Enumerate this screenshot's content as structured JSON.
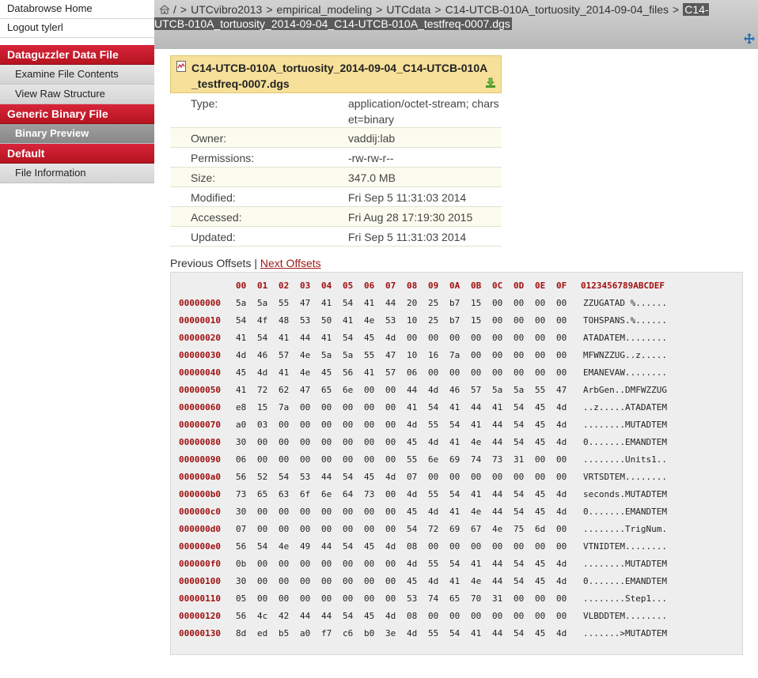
{
  "sidebar": {
    "top_links": [
      "Databrowse Home",
      "Logout tylerl"
    ],
    "sections": [
      {
        "title": "Dataguzzler Data File",
        "items": [
          {
            "label": "Examine File Contents",
            "active": false
          },
          {
            "label": "View Raw Structure",
            "active": false
          }
        ]
      },
      {
        "title": "Generic Binary File",
        "items": [
          {
            "label": "Binary Preview",
            "active": true
          }
        ]
      },
      {
        "title": "Default",
        "items": [
          {
            "label": "File Information",
            "active": false
          }
        ]
      }
    ]
  },
  "breadcrumb": {
    "parts": [
      "/",
      "UTCvibro2013",
      "empirical_modeling",
      "UTCdata",
      "C14-UTCB-010A_tortuosity_2014-09-04_files"
    ],
    "separator": ">",
    "current": "C14-UTCB-010A_tortuosity_2014-09-04_C14-UTCB-010A_testfreq-0007.dgs"
  },
  "file": {
    "title": "C14-UTCB-010A_tortuosity_2014-09-04_C14-UTCB-010A_testfreq-0007.dgs",
    "rows": [
      {
        "key": "Type:",
        "value": "application/octet-stream; charset=binary"
      },
      {
        "key": "Owner:",
        "value": "vaddij:lab"
      },
      {
        "key": "Permissions:",
        "value": "-rw-rw-r--"
      },
      {
        "key": "Size:",
        "value": "347.0 MB"
      },
      {
        "key": "Modified:",
        "value": "Fri Sep 5 11:31:03 2014"
      },
      {
        "key": "Accessed:",
        "value": "Fri Aug 28 17:19:30 2015"
      },
      {
        "key": "Updated:",
        "value": "Fri Sep 5 11:31:03 2014"
      }
    ]
  },
  "offsets": {
    "previous": "Previous Offsets",
    "divider": "|",
    "next": "Next Offsets"
  },
  "hex": {
    "columns": [
      "00",
      "01",
      "02",
      "03",
      "04",
      "05",
      "06",
      "07",
      "08",
      "09",
      "0A",
      "0B",
      "0C",
      "0D",
      "0E",
      "0F"
    ],
    "ascii_header": "0123456789ABCDEF",
    "rows": [
      {
        "offset": "00000000",
        "bytes": [
          "5a",
          "5a",
          "55",
          "47",
          "41",
          "54",
          "41",
          "44",
          "20",
          "25",
          "b7",
          "15",
          "00",
          "00",
          "00",
          "00"
        ],
        "ascii": "ZZUGATAD %......"
      },
      {
        "offset": "00000010",
        "bytes": [
          "54",
          "4f",
          "48",
          "53",
          "50",
          "41",
          "4e",
          "53",
          "10",
          "25",
          "b7",
          "15",
          "00",
          "00",
          "00",
          "00"
        ],
        "ascii": "TOHSPANS.%......"
      },
      {
        "offset": "00000020",
        "bytes": [
          "41",
          "54",
          "41",
          "44",
          "41",
          "54",
          "45",
          "4d",
          "00",
          "00",
          "00",
          "00",
          "00",
          "00",
          "00",
          "00"
        ],
        "ascii": "ATADATEM........"
      },
      {
        "offset": "00000030",
        "bytes": [
          "4d",
          "46",
          "57",
          "4e",
          "5a",
          "5a",
          "55",
          "47",
          "10",
          "16",
          "7a",
          "00",
          "00",
          "00",
          "00",
          "00"
        ],
        "ascii": "MFWNZZUG..z....."
      },
      {
        "offset": "00000040",
        "bytes": [
          "45",
          "4d",
          "41",
          "4e",
          "45",
          "56",
          "41",
          "57",
          "06",
          "00",
          "00",
          "00",
          "00",
          "00",
          "00",
          "00"
        ],
        "ascii": "EMANEVAW........"
      },
      {
        "offset": "00000050",
        "bytes": [
          "41",
          "72",
          "62",
          "47",
          "65",
          "6e",
          "00",
          "00",
          "44",
          "4d",
          "46",
          "57",
          "5a",
          "5a",
          "55",
          "47"
        ],
        "ascii": "ArbGen..DMFWZZUG"
      },
      {
        "offset": "00000060",
        "bytes": [
          "e8",
          "15",
          "7a",
          "00",
          "00",
          "00",
          "00",
          "00",
          "41",
          "54",
          "41",
          "44",
          "41",
          "54",
          "45",
          "4d"
        ],
        "ascii": "..z.....ATADATEM"
      },
      {
        "offset": "00000070",
        "bytes": [
          "a0",
          "03",
          "00",
          "00",
          "00",
          "00",
          "00",
          "00",
          "4d",
          "55",
          "54",
          "41",
          "44",
          "54",
          "45",
          "4d"
        ],
        "ascii": "........MUTADTEM"
      },
      {
        "offset": "00000080",
        "bytes": [
          "30",
          "00",
          "00",
          "00",
          "00",
          "00",
          "00",
          "00",
          "45",
          "4d",
          "41",
          "4e",
          "44",
          "54",
          "45",
          "4d"
        ],
        "ascii": "0.......EMANDTEM"
      },
      {
        "offset": "00000090",
        "bytes": [
          "06",
          "00",
          "00",
          "00",
          "00",
          "00",
          "00",
          "00",
          "55",
          "6e",
          "69",
          "74",
          "73",
          "31",
          "00",
          "00"
        ],
        "ascii": "........Units1.."
      },
      {
        "offset": "000000a0",
        "bytes": [
          "56",
          "52",
          "54",
          "53",
          "44",
          "54",
          "45",
          "4d",
          "07",
          "00",
          "00",
          "00",
          "00",
          "00",
          "00",
          "00"
        ],
        "ascii": "VRTSDTEM........"
      },
      {
        "offset": "000000b0",
        "bytes": [
          "73",
          "65",
          "63",
          "6f",
          "6e",
          "64",
          "73",
          "00",
          "4d",
          "55",
          "54",
          "41",
          "44",
          "54",
          "45",
          "4d"
        ],
        "ascii": "seconds.MUTADTEM"
      },
      {
        "offset": "000000c0",
        "bytes": [
          "30",
          "00",
          "00",
          "00",
          "00",
          "00",
          "00",
          "00",
          "45",
          "4d",
          "41",
          "4e",
          "44",
          "54",
          "45",
          "4d"
        ],
        "ascii": "0.......EMANDTEM"
      },
      {
        "offset": "000000d0",
        "bytes": [
          "07",
          "00",
          "00",
          "00",
          "00",
          "00",
          "00",
          "00",
          "54",
          "72",
          "69",
          "67",
          "4e",
          "75",
          "6d",
          "00"
        ],
        "ascii": "........TrigNum."
      },
      {
        "offset": "000000e0",
        "bytes": [
          "56",
          "54",
          "4e",
          "49",
          "44",
          "54",
          "45",
          "4d",
          "08",
          "00",
          "00",
          "00",
          "00",
          "00",
          "00",
          "00"
        ],
        "ascii": "VTNIDTEM........"
      },
      {
        "offset": "000000f0",
        "bytes": [
          "0b",
          "00",
          "00",
          "00",
          "00",
          "00",
          "00",
          "00",
          "4d",
          "55",
          "54",
          "41",
          "44",
          "54",
          "45",
          "4d"
        ],
        "ascii": "........MUTADTEM"
      },
      {
        "offset": "00000100",
        "bytes": [
          "30",
          "00",
          "00",
          "00",
          "00",
          "00",
          "00",
          "00",
          "45",
          "4d",
          "41",
          "4e",
          "44",
          "54",
          "45",
          "4d"
        ],
        "ascii": "0.......EMANDTEM"
      },
      {
        "offset": "00000110",
        "bytes": [
          "05",
          "00",
          "00",
          "00",
          "00",
          "00",
          "00",
          "00",
          "53",
          "74",
          "65",
          "70",
          "31",
          "00",
          "00",
          "00"
        ],
        "ascii": "........Step1..."
      },
      {
        "offset": "00000120",
        "bytes": [
          "56",
          "4c",
          "42",
          "44",
          "44",
          "54",
          "45",
          "4d",
          "08",
          "00",
          "00",
          "00",
          "00",
          "00",
          "00",
          "00"
        ],
        "ascii": "VLBDDTEM........"
      },
      {
        "offset": "00000130",
        "bytes": [
          "8d",
          "ed",
          "b5",
          "a0",
          "f7",
          "c6",
          "b0",
          "3e",
          "4d",
          "55",
          "54",
          "41",
          "44",
          "54",
          "45",
          "4d"
        ],
        "ascii": ".......>MUTADTEM"
      }
    ]
  },
  "colors": {
    "accent_red": "#c41e2e",
    "title_bg": "#f6e09a",
    "offset_red": "#a01010"
  }
}
